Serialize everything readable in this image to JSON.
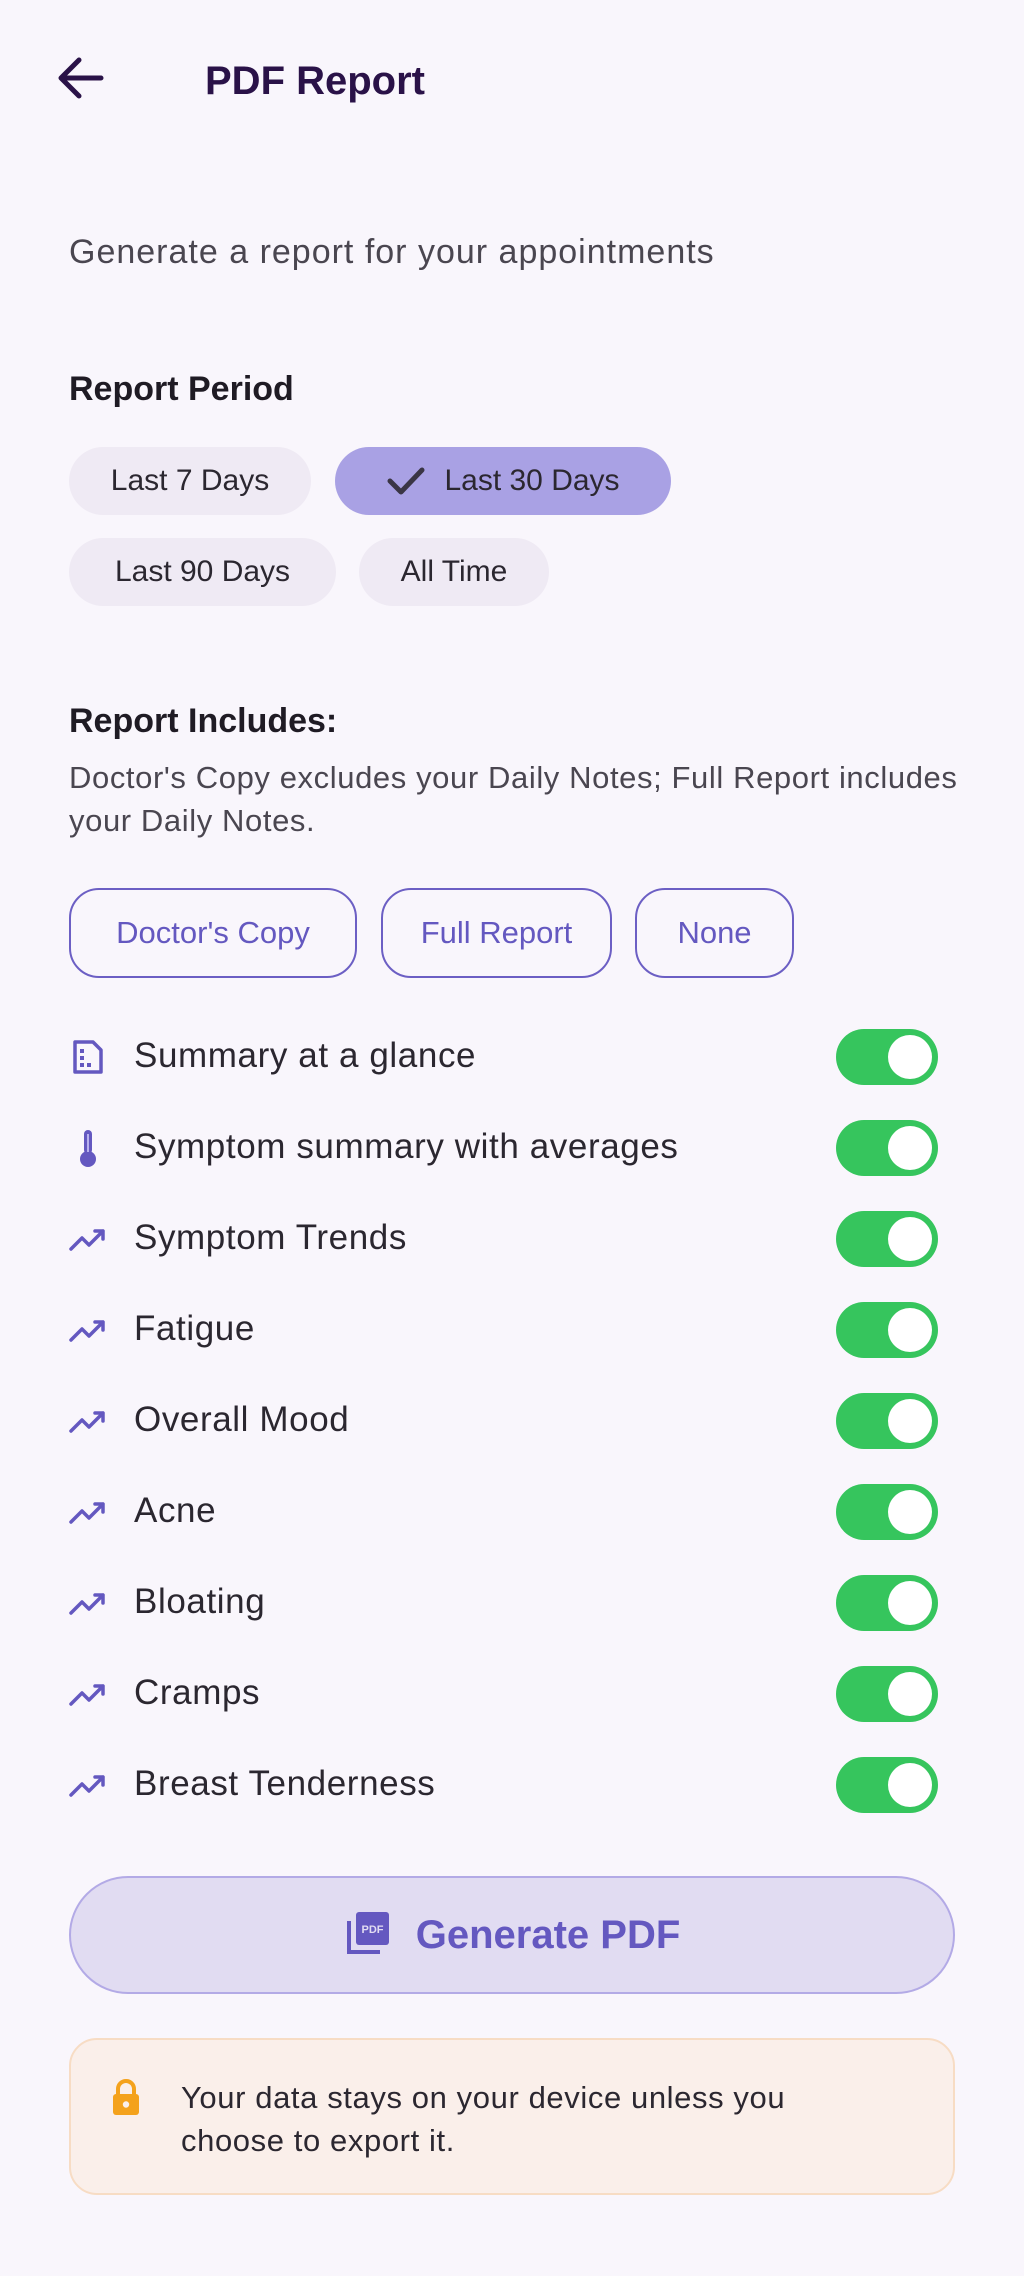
{
  "header": {
    "back_icon": "arrow-left-icon",
    "title": "PDF Report"
  },
  "subtitle": "Generate a report for your appointments",
  "period": {
    "title": "Report Period",
    "options": [
      "Last 7 Days",
      "Last 30 Days",
      "Last 90 Days",
      "All Time"
    ],
    "selected": "Last 30 Days",
    "selected_color": "#a9a1e4"
  },
  "includes": {
    "title": "Report Includes:",
    "description": "Doctor's Copy excludes your Daily Notes; Full Report includes your Daily Notes.",
    "presets": [
      "Doctor's Copy",
      "Full Report",
      "None"
    ],
    "items": [
      {
        "label": "Summary at a glance",
        "icon": "summary-icon",
        "enabled": true
      },
      {
        "label": "Symptom summary with averages",
        "icon": "thermometer-icon",
        "enabled": true
      },
      {
        "label": "Symptom Trends",
        "icon": "trend-icon",
        "enabled": true
      },
      {
        "label": "Fatigue",
        "icon": "trend-icon",
        "enabled": true
      },
      {
        "label": "Overall Mood",
        "icon": "trend-icon",
        "enabled": true
      },
      {
        "label": "Acne",
        "icon": "trend-icon",
        "enabled": true
      },
      {
        "label": "Bloating",
        "icon": "trend-icon",
        "enabled": true
      },
      {
        "label": "Cramps",
        "icon": "trend-icon",
        "enabled": true
      },
      {
        "label": "Breast Tenderness",
        "icon": "trend-icon",
        "enabled": true
      }
    ],
    "toggle_on_color": "#36c55d"
  },
  "generate_button": {
    "label": "Generate PDF",
    "icon": "pdf-icon"
  },
  "notice": {
    "icon": "lock-icon",
    "text": "Your data stays on your device unless you choose to export it."
  },
  "colors": {
    "accent": "#6458c0",
    "title": "#2a1248",
    "background": "#f9f6fc"
  }
}
